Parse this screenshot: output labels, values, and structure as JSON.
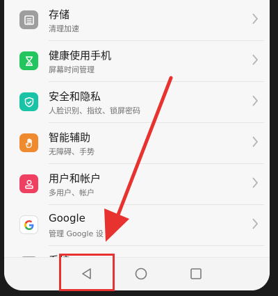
{
  "settings": {
    "items": [
      {
        "title": "存储",
        "subtitle": "清理加速",
        "icon": "storage-icon",
        "color": "#9e9e9e"
      },
      {
        "title": "健康使用手机",
        "subtitle": "屏幕时间管理",
        "icon": "hourglass-icon",
        "color": "#22c55e"
      },
      {
        "title": "安全和隐私",
        "subtitle": "人脸识别、指纹、锁屏密码",
        "icon": "shield-icon",
        "color": "#19c3a6"
      },
      {
        "title": "智能辅助",
        "subtitle": "无障碍、手势",
        "icon": "hand-icon",
        "color": "#f08a2e"
      },
      {
        "title": "用户和帐户",
        "subtitle": "多用户、帐户",
        "icon": "user-icon",
        "color": "#ef4062"
      },
      {
        "title": "Google",
        "subtitle": "管理 Google 设",
        "icon": "google-icon",
        "color": "#ffffff"
      },
      {
        "title": "系统",
        "subtitle": "",
        "icon": "system-icon",
        "color": "#9e9e9e"
      }
    ]
  },
  "navbar": {
    "back_icon": "back-triangle-icon",
    "home_icon": "home-circle-icon",
    "recents_icon": "recents-square-icon"
  },
  "annotation": {
    "color": "#e8322f"
  }
}
